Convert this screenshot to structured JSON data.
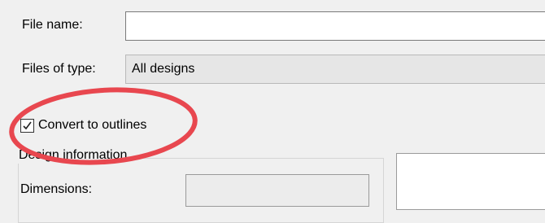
{
  "form": {
    "file_name_label": "File name:",
    "file_name_value": "",
    "files_of_type_label": "Files of type:",
    "files_of_type_value": "All designs"
  },
  "options": {
    "convert_to_outlines_label": "Convert to outlines",
    "convert_to_outlines_checked": true
  },
  "design_info": {
    "title": "Design information",
    "dimensions_label": "Dimensions:",
    "dimensions_value": ""
  },
  "annotation": {
    "color": "#e8474f",
    "icon": "highlight-ellipse"
  }
}
